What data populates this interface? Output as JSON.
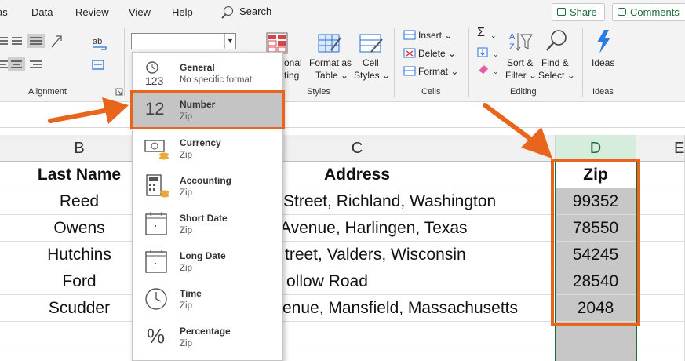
{
  "menu": {
    "items": [
      "as",
      "Data",
      "Review",
      "View",
      "Help"
    ],
    "search": "Search"
  },
  "top_buttons": {
    "share": "Share",
    "comments": "Comments"
  },
  "ribbon": {
    "alignment_label": "Alignment",
    "styles_label": "Styles",
    "cells_label": "Cells",
    "editing_label": "Editing",
    "ideas_label": "Ideas",
    "conditional_partial": "onal",
    "conditional_partial2": "ting",
    "format_as": "Format as",
    "table": "Table",
    "cell": "Cell",
    "styles": "Styles",
    "insert": "Insert",
    "delete": "Delete",
    "format": "Format",
    "sort": "Sort &",
    "filter": "Filter",
    "find": "Find &",
    "select": "Select",
    "ideas": "Ideas",
    "sigma": "Σ"
  },
  "number_format_dropdown": {
    "current_value": "",
    "items": [
      {
        "title": "General",
        "subtitle": "No specific format",
        "icon": "123"
      },
      {
        "title": "Number",
        "subtitle": "Zip",
        "icon": "12"
      },
      {
        "title": "Currency",
        "subtitle": "Zip",
        "icon": "currency-icon"
      },
      {
        "title": "Accounting",
        "subtitle": "Zip",
        "icon": "accounting-icon"
      },
      {
        "title": "Short Date",
        "subtitle": "Zip",
        "icon": "calendar-icon"
      },
      {
        "title": "Long Date",
        "subtitle": "Zip",
        "icon": "calendar-icon"
      },
      {
        "title": "Time",
        "subtitle": "Zip",
        "icon": "clock-icon"
      },
      {
        "title": "Percentage",
        "subtitle": "Zip",
        "icon": "%"
      }
    ]
  },
  "spreadsheet": {
    "columns": [
      "B",
      "C",
      "D",
      "E"
    ],
    "headers": {
      "last_name": "Last Name",
      "address": "Address",
      "zip": "Zip"
    },
    "rows": [
      {
        "last_name": "Reed",
        "address": "Street, Richland, Washington",
        "zip": "99352"
      },
      {
        "last_name": "Owens",
        "address": "Avenue, Harlingen, Texas",
        "zip": "78550"
      },
      {
        "last_name": "Hutchins",
        "address": "treet, Valders, Wisconsin",
        "zip": "54245"
      },
      {
        "last_name": "Ford",
        "address": "ollow Road",
        "zip": "28540"
      },
      {
        "last_name": "Scudder",
        "address": "enue, Mansfield, Massachusetts",
        "zip": "2048"
      }
    ]
  },
  "colors": {
    "highlight": "#e8651c",
    "accent_green": "#1e6b3a",
    "selected_zip_bg": "#c7c7c7",
    "selected_col_header": "#d6ecdd"
  }
}
